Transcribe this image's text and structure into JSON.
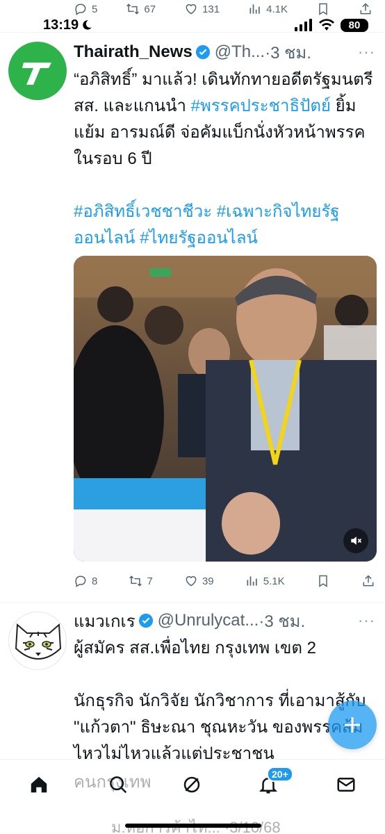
{
  "previous_tweet_actions": {
    "replies": "5",
    "retweets": "67",
    "likes": "131",
    "views": "4.1K"
  },
  "status_bar": {
    "time": "13:19",
    "battery": "80"
  },
  "tweets": [
    {
      "name": "Thairath_News",
      "handle": "@Th...",
      "time": "·3 ชม.",
      "text_parts": [
        "“อภิสิทธิ์” มาแล้ว! เดินทักทายอดีตรัฐมนตรี สส. และแกนนำ ",
        "#พรรคประชาธิปัตย์",
        " ยิ้มแย้ม อารมณ์ดี จ่อคัมแบ็กนั่งหัวหน้าพรรคในรอบ 6 ปี"
      ],
      "hashtags": [
        "#อภิสิทธิ์เวชชาชีวะ",
        "#เฉพาะกิจไทยรัฐออนไลน์",
        "#ไทยรัฐออนไลน์"
      ],
      "actions": {
        "replies": "8",
        "retweets": "7",
        "likes": "39",
        "views": "5.1K"
      }
    },
    {
      "name": "แมวเกเร",
      "handle": "@Unrulycat...",
      "time": "·3 ชม.",
      "line1": "ผู้สมัคร สส.เพื่อไทย กรุงเทพ เขต 2",
      "body": "นักธุรกิจ นักวิจัย นักวิชาการ ที่เอามาสู้กับ \"แก้วตา\" ธิษะณา ชุณหะวัน ของพรรคส้ม ไหวไม่ไหวแล้วแต่ประชาชน",
      "body_tail": "คนกรุงเทพ",
      "quoted_preview": "ม.หอการค้าไท...  ·3/10/68"
    }
  ],
  "bottom_nav": {
    "notifications_badge": "20+"
  },
  "colors": {
    "accent": "#1d9bf0",
    "secondary_text": "#536471",
    "thairath_green": "#2db34a"
  }
}
